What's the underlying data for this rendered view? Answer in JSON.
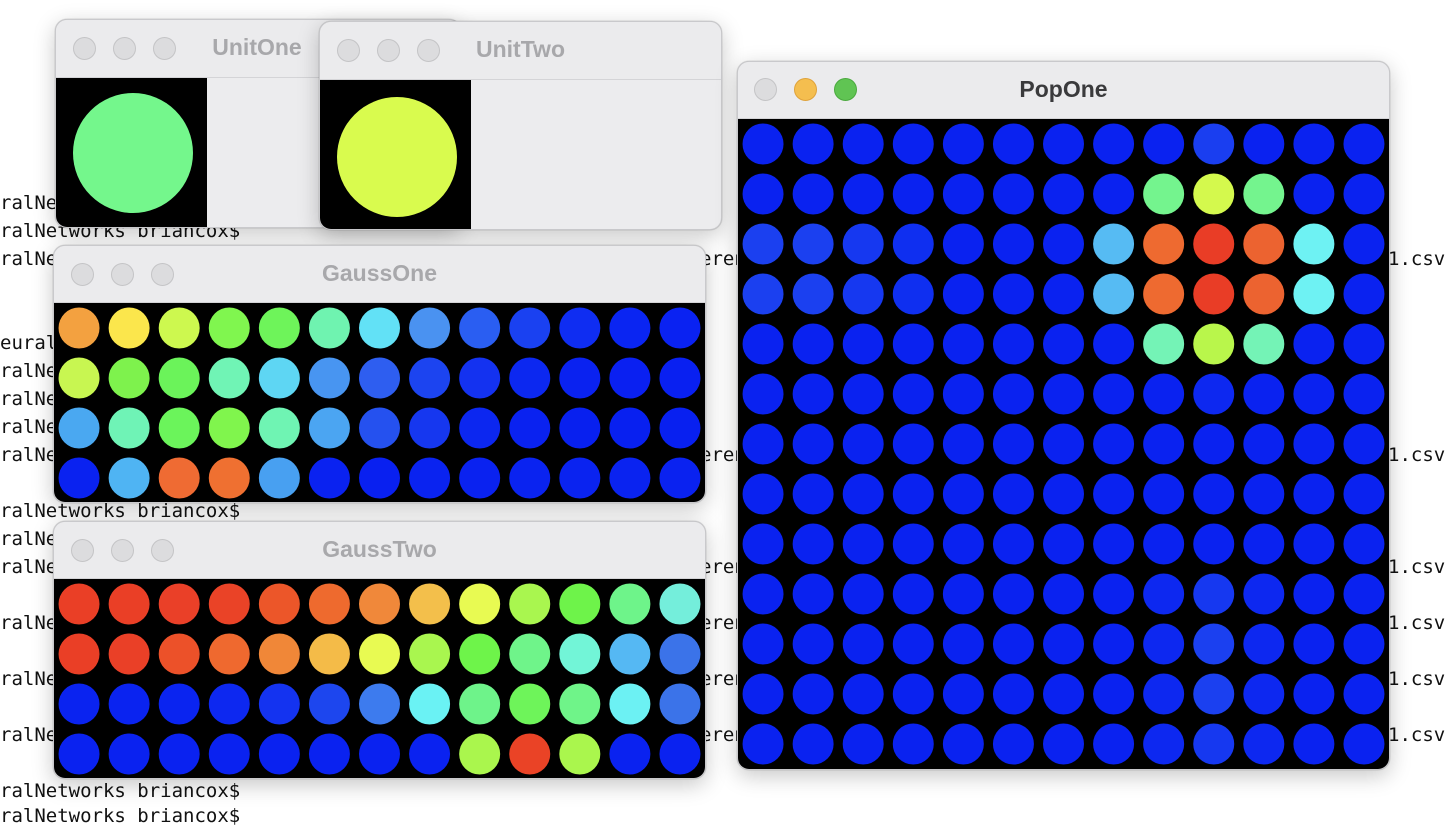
{
  "terminal": {
    "left_lines": [
      "ralNet",
      "ralNetworks briancox$",
      "ralNet",
      "euralN",
      "ralNet",
      "ralNet",
      "ralNet",
      "ralNet",
      "ralNetworks briancox$",
      "ralNet",
      "ralNet",
      "ralNet",
      "ralNet",
      "ralNet",
      "ralNetworks briancox$",
      "ralNetworks briancox$"
    ],
    "middle_fragments": [
      "eren",
      "eren",
      "eren",
      "eren",
      "eren",
      "eren",
      "eren"
    ],
    "right_fragments": [
      "1.csv",
      "1.csv",
      "1.csv",
      "1.csv",
      "1.csv",
      "1.csv",
      "1.csv"
    ]
  },
  "windows": {
    "unit_one": {
      "title": "UnitOne",
      "circle_color": "#74f78c"
    },
    "unit_two": {
      "title": "UnitTwo",
      "circle_color": "#d9fb4e"
    },
    "gauss_one": {
      "title": "GaussOne",
      "grid": [
        [
          "#f3a140",
          "#fbe64c",
          "#cdf84f",
          "#80f64f",
          "#6ef45a",
          "#6ff3b0",
          "#62e1f6",
          "#4a92f1",
          "#2a5ef2",
          "#1a41f1",
          "#0f2df2",
          "#0a25f2",
          "#0a22f2"
        ],
        [
          "#c8f651",
          "#7ef24d",
          "#6bf35a",
          "#70f4b5",
          "#5ed6f3",
          "#4895f1",
          "#2e5ef0",
          "#1c44f0",
          "#1432f0",
          "#0c28f0",
          "#0a22f0",
          "#0a20f1",
          "#0920f1"
        ],
        [
          "#4aa8f1",
          "#6ff3b6",
          "#6bf45b",
          "#80f54d",
          "#6ff4b3",
          "#4ba5f2",
          "#2551ef",
          "#1637ef",
          "#0c27f0",
          "#0a22f0",
          "#0820ef",
          "#0820f0",
          "#0820f0"
        ],
        [
          "#0a22f0",
          "#4fb4f3",
          "#ef6b33",
          "#ef7031",
          "#48a0f1",
          "#0a22f0",
          "#0920f0",
          "#0a23f0",
          "#0a22f0",
          "#0a23f0",
          "#0a23f0",
          "#0a23f0",
          "#0a22f0"
        ]
      ]
    },
    "gauss_two": {
      "title": "GaussTwo",
      "grid": [
        [
          "#ea3f26",
          "#ea3f26",
          "#ea4028",
          "#ea4327",
          "#ec5629",
          "#ee6a2e",
          "#f0883a",
          "#f3bf4b",
          "#e8fa52",
          "#a9f64f",
          "#6ef34a",
          "#6ef48a",
          "#74eedb"
        ],
        [
          "#ea3f26",
          "#ea4027",
          "#ec5129",
          "#ef692f",
          "#f08738",
          "#f4bb48",
          "#e8fa52",
          "#a9f64f",
          "#6ef44a",
          "#6ff48a",
          "#72f5d7",
          "#55b8f3",
          "#3b73e9"
        ],
        [
          "#0a23f0",
          "#0a23f0",
          "#0a24f0",
          "#0d28f0",
          "#1433f0",
          "#1d46ee",
          "#3d7bee",
          "#6af2f4",
          "#6ef38a",
          "#6ef45a",
          "#6ff489",
          "#6cf1f3",
          "#3b73e9"
        ],
        [
          "#0a22f0",
          "#0a22f0",
          "#0a22f0",
          "#0a22f0",
          "#0a22f0",
          "#0a22f0",
          "#0a22f0",
          "#0a22f0",
          "#aaf64d",
          "#ea4326",
          "#aaf64d",
          "#0a22f0",
          "#0a22f0"
        ]
      ]
    },
    "pop_one": {
      "title": "PopOne",
      "grid": [
        [
          "#0a22f0",
          "#0a22f0",
          "#0a22f0",
          "#0a22f0",
          "#0a22f0",
          "#0a22f0",
          "#0a22f0",
          "#0a22f0",
          "#0a22f0",
          "#1a3ef0",
          "#0a22f0",
          "#0a22f0",
          "#0a22f0"
        ],
        [
          "#0a22f0",
          "#0a22f0",
          "#0a22f0",
          "#0a22f0",
          "#0a22f0",
          "#0a22f0",
          "#0a22f0",
          "#0a22f0",
          "#74f48e",
          "#d4f94d",
          "#74f48e",
          "#0a22f0",
          "#0a22f0"
        ],
        [
          "#1b40f0",
          "#1b40f0",
          "#1638f0",
          "#0f2ff0",
          "#0a22f0",
          "#0a22f0",
          "#0a22f0",
          "#56bbf3",
          "#ee6a30",
          "#e93d26",
          "#ec6330",
          "#6ef2f3",
          "#0a22f0"
        ],
        [
          "#1b40f0",
          "#1b40f0",
          "#1638f0",
          "#0f2ff0",
          "#0a22f0",
          "#0a22f0",
          "#0a22f0",
          "#56bbf3",
          "#ee6a30",
          "#e93d26",
          "#ec6330",
          "#6ef2f3",
          "#0a22f0"
        ],
        [
          "#0a22f0",
          "#0a22f0",
          "#0a22f0",
          "#0a22f0",
          "#0a22f0",
          "#0a22f0",
          "#0a22f0",
          "#0a22f0",
          "#74f3b6",
          "#b9f64b",
          "#74f3b6",
          "#0a22f0",
          "#0a22f0"
        ],
        [
          "#0a22f0",
          "#0a22f0",
          "#0a22f0",
          "#0a22f0",
          "#0a22f0",
          "#0a22f0",
          "#0a22f0",
          "#0a22f0",
          "#0a22f0",
          "#0d28f0",
          "#0a22f0",
          "#0a22f0",
          "#0a22f0"
        ],
        [
          "#0a22f0",
          "#0a22f0",
          "#0a22f0",
          "#0a22f0",
          "#0a22f0",
          "#0a22f0",
          "#0a22f0",
          "#0a22f0",
          "#0a22f0",
          "#0a22f0",
          "#0a22f0",
          "#0a22f0",
          "#0a22f0"
        ],
        [
          "#0a22f0",
          "#0a22f0",
          "#0a22f0",
          "#0a22f0",
          "#0a22f0",
          "#0a22f0",
          "#0a22f0",
          "#0a22f0",
          "#0a22f0",
          "#0a22f0",
          "#0a22f0",
          "#0a22f0",
          "#0a22f0"
        ],
        [
          "#0a22f0",
          "#0a22f0",
          "#0a22f0",
          "#0a22f0",
          "#0a22f0",
          "#0a22f0",
          "#0a22f0",
          "#0a22f0",
          "#0a22f0",
          "#0a22f0",
          "#0a22f0",
          "#0a22f0",
          "#0a22f0"
        ],
        [
          "#0a22f0",
          "#0a22f0",
          "#0a22f0",
          "#0a22f0",
          "#0a22f0",
          "#0a22f0",
          "#0a22f0",
          "#0a22f0",
          "#0d28f0",
          "#1638f0",
          "#0d28f0",
          "#0a22f0",
          "#0a22f0"
        ],
        [
          "#0a22f0",
          "#0a22f0",
          "#0a22f0",
          "#0a22f0",
          "#0a22f0",
          "#0a22f0",
          "#0a22f0",
          "#0a22f0",
          "#0d28f0",
          "#1b40f0",
          "#0d28f0",
          "#0a22f0",
          "#0a22f0"
        ],
        [
          "#0a22f0",
          "#0a22f0",
          "#0a22f0",
          "#0a22f0",
          "#0a22f0",
          "#0a22f0",
          "#0a22f0",
          "#0a22f0",
          "#0d28f0",
          "#1b40f0",
          "#0d28f0",
          "#0a22f0",
          "#0a22f0"
        ],
        [
          "#0a22f0",
          "#0a22f0",
          "#0a22f0",
          "#0a22f0",
          "#0a22f0",
          "#0a22f0",
          "#0a22f0",
          "#0a22f0",
          "#0d28f0",
          "#1638f0",
          "#0d28f0",
          "#0a22f0",
          "#0a22f0"
        ]
      ]
    }
  }
}
